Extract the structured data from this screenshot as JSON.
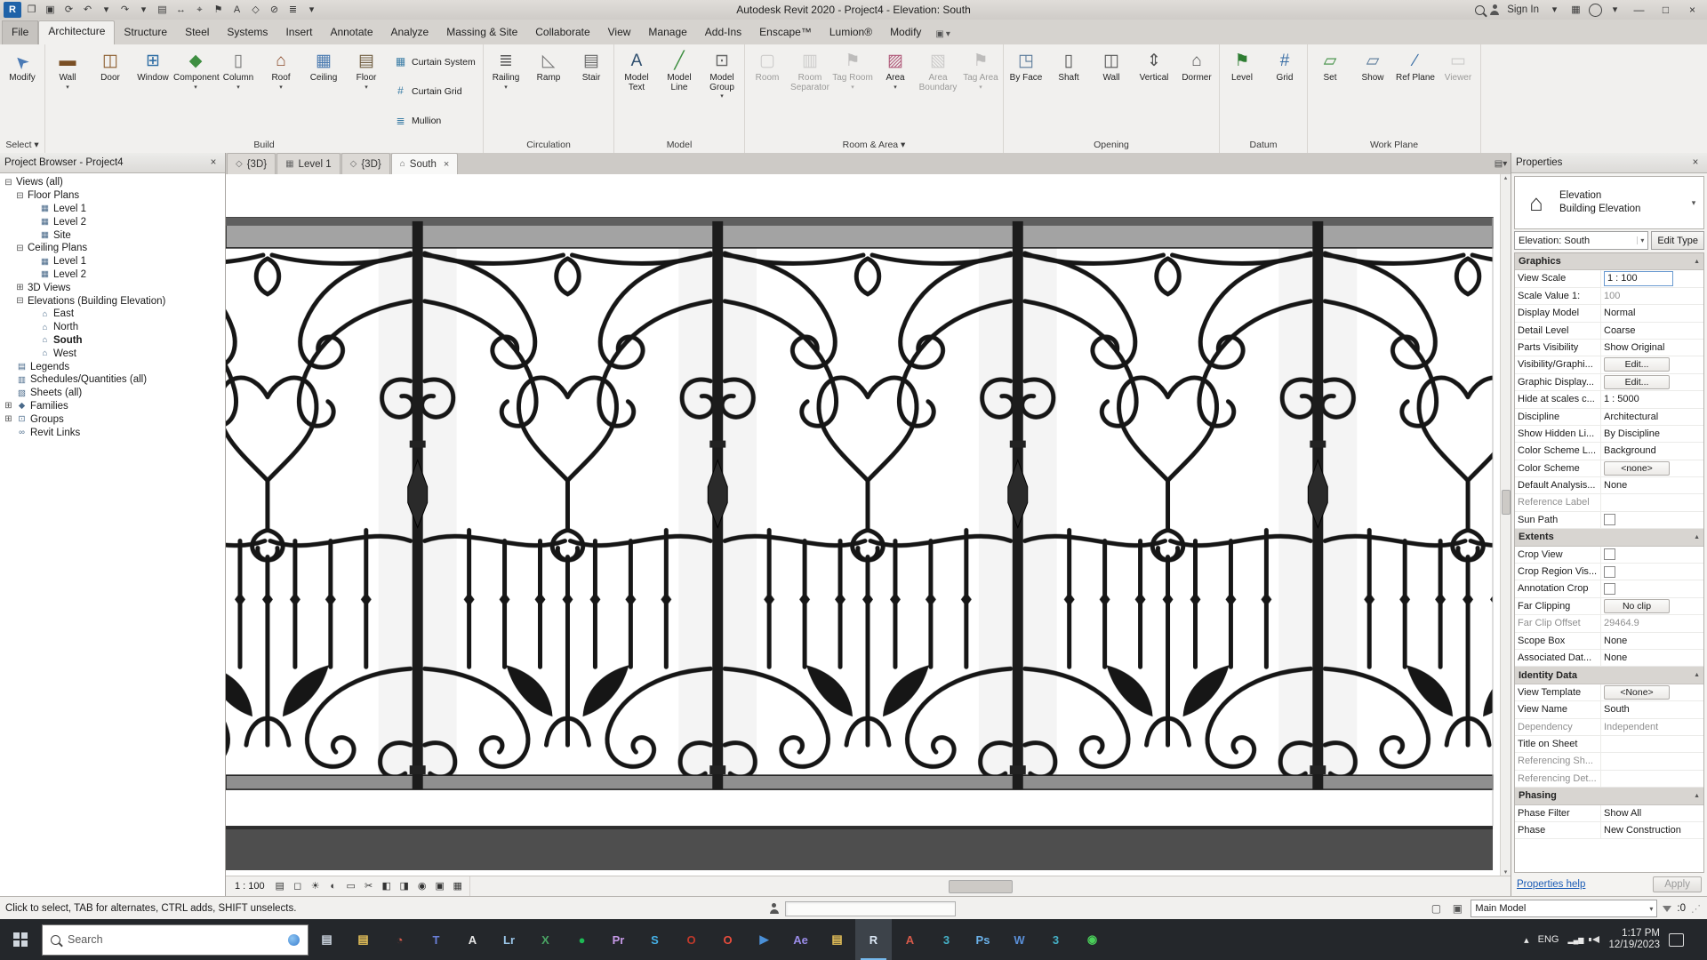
{
  "title_bar": {
    "title": "Autodesk Revit 2020 - Project4 - Elevation: South",
    "sign_in": "Sign In",
    "quick_access": [
      {
        "name": "application-menu-button",
        "glyph": "R"
      },
      {
        "name": "open-button",
        "glyph": "❐"
      },
      {
        "name": "save-button",
        "glyph": "▣"
      },
      {
        "name": "sync-with-central-button",
        "glyph": "⟳"
      },
      {
        "name": "undo-button",
        "glyph": "↶"
      },
      {
        "name": "undo-dropdown",
        "glyph": "▾"
      },
      {
        "name": "redo-button",
        "glyph": "↷"
      },
      {
        "name": "redo-dropdown",
        "glyph": "▾"
      },
      {
        "name": "print-button",
        "glyph": "▤"
      },
      {
        "name": "measure-button",
        "glyph": "↔"
      },
      {
        "name": "aligned-dimension-button",
        "glyph": "⌖"
      },
      {
        "name": "tag-by-category-button",
        "glyph": "⚑"
      },
      {
        "name": "text-button",
        "glyph": "A"
      },
      {
        "name": "default-3d-view-button",
        "glyph": "◇"
      },
      {
        "name": "section-button",
        "glyph": "⊘"
      },
      {
        "name": "thin-lines-button",
        "glyph": "≣"
      },
      {
        "name": "customize-quick-access-dropdown",
        "glyph": "▾"
      }
    ],
    "right_controls": [
      {
        "name": "search-icon",
        "glyph": "css-mag"
      },
      {
        "name": "user-icon",
        "glyph": "css-user"
      },
      {
        "name": "sign-in-button",
        "glyph": "",
        "use_label": "sign_in"
      },
      {
        "name": "sign-in-dropdown",
        "glyph": "▾"
      },
      {
        "name": "app-store-icon",
        "glyph": "▦"
      },
      {
        "name": "help-icon",
        "glyph": "css-help"
      },
      {
        "name": "help-dropdown",
        "glyph": "▾"
      },
      {
        "name": "minimize-button",
        "glyph": "—",
        "win": true
      },
      {
        "name": "maximize-button",
        "glyph": "□",
        "win": true
      },
      {
        "name": "close-button",
        "glyph": "×",
        "win": true
      }
    ]
  },
  "ribbon": {
    "tabs": [
      "File",
      "Architecture",
      "Structure",
      "Steel",
      "Systems",
      "Insert",
      "Annotate",
      "Analyze",
      "Massing & Site",
      "Collaborate",
      "View",
      "Manage",
      "Add-Ins",
      "Enscape™",
      "Lumion®",
      "Modify"
    ],
    "active_tab": "Architecture",
    "panels": [
      {
        "label": "Select",
        "arrow": true,
        "tools": [
          {
            "label": "Modify",
            "icon": "modify",
            "glyph": "➤",
            "color": "#4a7ab5"
          }
        ]
      },
      {
        "label": "Build",
        "tools": [
          {
            "label": "Wall",
            "icon": "wall",
            "glyph": "▬",
            "color": "#7a4f24",
            "arrow": true
          },
          {
            "label": "Door",
            "icon": "door",
            "glyph": "◫",
            "color": "#8a5a2a"
          },
          {
            "label": "Window",
            "icon": "window",
            "glyph": "⊞",
            "color": "#2e6da4"
          },
          {
            "label": "Component",
            "icon": "component",
            "glyph": "◆",
            "color": "#3e8e41",
            "arrow": true
          },
          {
            "label": "Column",
            "icon": "column",
            "glyph": "▯",
            "color": "#777777",
            "arrow": true
          },
          {
            "label": "Roof",
            "icon": "roof",
            "glyph": "⌂",
            "color": "#8a4a2a",
            "arrow": true
          },
          {
            "label": "Ceiling",
            "icon": "ceiling",
            "glyph": "▦",
            "color": "#4a7ab0"
          },
          {
            "label": "Floor",
            "icon": "floor",
            "glyph": "▤",
            "color": "#6e5b3e",
            "arrow": true
          }
        ],
        "stack": [
          {
            "label": "Curtain System",
            "icon": "curtain-system",
            "glyph": "▦",
            "color": "#3a7ca5"
          },
          {
            "label": "Curtain Grid",
            "icon": "curtain-grid",
            "glyph": "#",
            "color": "#3a7ca5"
          },
          {
            "label": "Mullion",
            "icon": "mullion",
            "glyph": "≣",
            "color": "#3a7ca5"
          }
        ]
      },
      {
        "label": "Circulation",
        "tools": [
          {
            "label": "Railing",
            "icon": "railing",
            "glyph": "≣",
            "color": "#555555",
            "arrow": true
          },
          {
            "label": "Ramp",
            "icon": "ramp",
            "glyph": "◺",
            "color": "#777777"
          },
          {
            "label": "Stair",
            "icon": "stair",
            "glyph": "▤",
            "color": "#666666"
          }
        ]
      },
      {
        "label": "Model",
        "tools": [
          {
            "label": "Model Text",
            "icon": "model-text",
            "glyph": "A",
            "color": "#2e4e6e"
          },
          {
            "label": "Model Line",
            "icon": "model-line",
            "glyph": "╱",
            "color": "#3e8e41"
          },
          {
            "label": "Model Group",
            "icon": "model-group",
            "glyph": "⊡",
            "color": "#666666",
            "arrow": true
          }
        ]
      },
      {
        "label": "Room & Area",
        "arrow": true,
        "tools": [
          {
            "label": "Room",
            "icon": "room",
            "glyph": "▢",
            "color": "#9a9a9a",
            "disabled": true
          },
          {
            "label": "Room Separator",
            "icon": "room-separator",
            "glyph": "▥",
            "color": "#9a9a9a",
            "disabled": true
          },
          {
            "label": "Tag Room",
            "icon": "tag-room",
            "glyph": "⚑",
            "color": "#777777",
            "arrow": true,
            "disabled": true
          },
          {
            "label": "Area",
            "icon": "area",
            "glyph": "▨",
            "color": "#b05a7a",
            "arrow": true
          },
          {
            "label": "Area Boundary",
            "icon": "area-boundary",
            "glyph": "▧",
            "color": "#9a9a9a",
            "disabled": true
          },
          {
            "label": "Tag Area",
            "icon": "tag-area",
            "glyph": "⚑",
            "color": "#777777",
            "arrow": true,
            "disabled": true
          }
        ]
      },
      {
        "label": "Opening",
        "tools": [
          {
            "label": "By Face",
            "icon": "opening-by-face",
            "glyph": "◳",
            "color": "#5a7a9a"
          },
          {
            "label": "Shaft",
            "icon": "shaft-opening",
            "glyph": "▯",
            "color": "#555555"
          },
          {
            "label": "Wall",
            "icon": "wall-opening",
            "glyph": "◫",
            "color": "#555555"
          },
          {
            "label": "Vertical",
            "icon": "vertical-opening",
            "glyph": "⇕",
            "color": "#555555"
          },
          {
            "label": "Dormer",
            "icon": "dormer-opening",
            "glyph": "⌂",
            "color": "#555555"
          }
        ]
      },
      {
        "label": "Datum",
        "tools": [
          {
            "label": "Level",
            "icon": "level",
            "glyph": "⚑",
            "color": "#2e7d32"
          },
          {
            "label": "Grid",
            "icon": "grid",
            "glyph": "#",
            "color": "#3a6ea5"
          }
        ]
      },
      {
        "label": "Work Plane",
        "tools": [
          {
            "label": "Set",
            "icon": "set-work-plane",
            "glyph": "▱",
            "color": "#3e8e41"
          },
          {
            "label": "Show",
            "icon": "show-work-plane",
            "glyph": "▱",
            "color": "#5a7a9a"
          },
          {
            "label": "Ref Plane",
            "icon": "ref-plane",
            "glyph": "∕",
            "color": "#3a6ea5"
          },
          {
            "label": "Viewer",
            "icon": "viewer",
            "glyph": "▭",
            "color": "#9a9a9a",
            "disabled": true
          }
        ]
      }
    ],
    "display_toggle_glyphs": [
      "▣",
      "▾"
    ]
  },
  "project_browser": {
    "title": "Project Browser - Project4",
    "close_glyph": "×",
    "icon_glyphs": {
      "plan": "▦",
      "elev": "⌂",
      "legend": "▤",
      "schedule": "▥",
      "sheet": "▧",
      "family": "◆",
      "group": "⊡",
      "link": "∞",
      "3d": "◇"
    },
    "tree": [
      {
        "label": "Views (all)",
        "depth": 0,
        "exp": "-"
      },
      {
        "label": "Floor Plans",
        "depth": 1,
        "exp": "-"
      },
      {
        "label": "Level 1",
        "depth": 2,
        "icon": "plan"
      },
      {
        "label": "Level 2",
        "depth": 2,
        "icon": "plan"
      },
      {
        "label": "Site",
        "depth": 2,
        "icon": "plan"
      },
      {
        "label": "Ceiling Plans",
        "depth": 1,
        "exp": "-"
      },
      {
        "label": "Level 1",
        "depth": 2,
        "icon": "plan"
      },
      {
        "label": "Level 2",
        "depth": 2,
        "icon": "plan"
      },
      {
        "label": "3D Views",
        "depth": 1,
        "exp": "+"
      },
      {
        "label": "Elevations (Building Elevation)",
        "depth": 1,
        "exp": "-"
      },
      {
        "label": "East",
        "depth": 2,
        "icon": "elev"
      },
      {
        "label": "North",
        "depth": 2,
        "icon": "elev"
      },
      {
        "label": "South",
        "depth": 2,
        "icon": "elev",
        "selected": true
      },
      {
        "label": "West",
        "depth": 2,
        "icon": "elev"
      },
      {
        "label": "Legends",
        "depth": 0,
        "icon": "legend"
      },
      {
        "label": "Schedules/Quantities (all)",
        "depth": 0,
        "icon": "schedule"
      },
      {
        "label": "Sheets (all)",
        "depth": 0,
        "icon": "sheet"
      },
      {
        "label": "Families",
        "depth": 0,
        "exp": "+",
        "icon": "family"
      },
      {
        "label": "Groups",
        "depth": 0,
        "exp": "+",
        "icon": "group"
      },
      {
        "label": "Revit Links",
        "depth": 0,
        "icon": "link"
      }
    ]
  },
  "view_tabs": [
    {
      "label": "{3D}",
      "icon": "3d"
    },
    {
      "label": "Level 1",
      "icon": "plan"
    },
    {
      "label": "{3D}",
      "icon": "3d"
    },
    {
      "label": "South",
      "icon": "elev",
      "active": true
    }
  ],
  "properties": {
    "title": "Properties",
    "close_glyph": "×",
    "type_name": "Elevation",
    "type_category": "Building Elevation",
    "selector": "Elevation: South",
    "edit_type": "Edit Type",
    "groups": [
      {
        "name": "Graphics",
        "rows": [
          {
            "l": "View Scale",
            "v": "1 : 100",
            "k": "input"
          },
          {
            "l": "Scale Value    1:",
            "v": "100",
            "k": "dim"
          },
          {
            "l": "Display Model",
            "v": "Normal",
            "k": "text"
          },
          {
            "l": "Detail Level",
            "v": "Coarse",
            "k": "text"
          },
          {
            "l": "Parts Visibility",
            "v": "Show Original",
            "k": "text"
          },
          {
            "l": "Visibility/Graphi...",
            "v": "Edit...",
            "k": "btn"
          },
          {
            "l": "Graphic Display...",
            "v": "Edit...",
            "k": "btn"
          },
          {
            "l": "Hide at scales c...",
            "v": "1 : 5000",
            "k": "text"
          },
          {
            "l": "Discipline",
            "v": "Architectural",
            "k": "text"
          },
          {
            "l": "Show Hidden Li...",
            "v": "By Discipline",
            "k": "text"
          },
          {
            "l": "Color Scheme L...",
            "v": "Background",
            "k": "text"
          },
          {
            "l": "Color Scheme",
            "v": "<none>",
            "k": "btn"
          },
          {
            "l": "Default Analysis...",
            "v": "None",
            "k": "text"
          },
          {
            "l": "Reference Label",
            "v": "",
            "k": "empty",
            "ld": true
          },
          {
            "l": "Sun Path",
            "v": "",
            "k": "check"
          }
        ]
      },
      {
        "name": "Extents",
        "rows": [
          {
            "l": "Crop View",
            "v": "",
            "k": "check"
          },
          {
            "l": "Crop Region Vis...",
            "v": "",
            "k": "check"
          },
          {
            "l": "Annotation Crop",
            "v": "",
            "k": "check"
          },
          {
            "l": "Far Clipping",
            "v": "No clip",
            "k": "btn"
          },
          {
            "l": "Far Clip Offset",
            "v": "29464.9",
            "k": "dim",
            "ld": true
          },
          {
            "l": "Scope Box",
            "v": "None",
            "k": "text"
          },
          {
            "l": "Associated Dat...",
            "v": "None",
            "k": "text"
          }
        ]
      },
      {
        "name": "Identity Data",
        "rows": [
          {
            "l": "View Template",
            "v": "<None>",
            "k": "btn"
          },
          {
            "l": "View Name",
            "v": "South",
            "k": "text"
          },
          {
            "l": "Dependency",
            "v": "Independent",
            "k": "dim",
            "ld": true
          },
          {
            "l": "Title on Sheet",
            "v": "",
            "k": "empty"
          },
          {
            "l": "Referencing Sh...",
            "v": "",
            "k": "empty",
            "ld": true
          },
          {
            "l": "Referencing Det...",
            "v": "",
            "k": "empty",
            "ld": true
          }
        ]
      },
      {
        "name": "Phasing",
        "rows": [
          {
            "l": "Phase Filter",
            "v": "Show All",
            "k": "text"
          },
          {
            "l": "Phase",
            "v": "New Construction",
            "k": "text"
          }
        ]
      }
    ],
    "help": "Properties help",
    "apply": "Apply"
  },
  "view_control_bar": {
    "scale": "1 : 100",
    "icons": [
      {
        "name": "detail-level-icon",
        "glyph": "▤"
      },
      {
        "name": "visual-style-icon",
        "glyph": "◻"
      },
      {
        "name": "sun-path-icon",
        "glyph": "☀"
      },
      {
        "name": "shadows-icon",
        "glyph": "◐"
      },
      {
        "name": "rendering-dialog-icon",
        "glyph": "▭"
      },
      {
        "name": "crop-view-icon",
        "glyph": "✂"
      },
      {
        "name": "crop-region-icon",
        "glyph": "◧"
      },
      {
        "name": "temporary-hide-icon",
        "glyph": "◨"
      },
      {
        "name": "reveal-hidden-icon",
        "glyph": "◉"
      },
      {
        "name": "temporary-view-properties-icon",
        "glyph": "▣"
      },
      {
        "name": "analysis-icon",
        "glyph": "▦"
      }
    ]
  },
  "status_bar": {
    "hint": "Click to select, TAB for alternates, CTRL adds, SHIFT unselects.",
    "main_model": "Main Model",
    "selection_count": ":0",
    "right_icons": [
      {
        "name": "design-options-icon",
        "glyph": "▣"
      },
      {
        "name": "exclude-options-icon",
        "glyph": "▢"
      }
    ]
  },
  "taskbar": {
    "search_placeholder": "Search",
    "language": "ENG",
    "time": "1:17 PM",
    "date": "12/19/2023",
    "apps": [
      {
        "name": "this-pc",
        "glyph": "▤",
        "fg": "#cfd8e3"
      },
      {
        "name": "file-explorer",
        "glyph": "▤",
        "fg": "#e8c35a"
      },
      {
        "name": "browser",
        "glyph": "◔",
        "fg": "#d85a4a"
      },
      {
        "name": "teams",
        "glyph": "T",
        "fg": "#6a7fd8"
      },
      {
        "name": "notepad",
        "glyph": "A",
        "fg": "#e8e8e8"
      },
      {
        "name": "lightroom",
        "glyph": "Lr",
        "fg": "#9ac5e8"
      },
      {
        "name": "excel",
        "glyph": "X",
        "fg": "#4aa564"
      },
      {
        "name": "spotify",
        "glyph": "●",
        "fg": "#1db954"
      },
      {
        "name": "premiere",
        "glyph": "Pr",
        "fg": "#c79ae8"
      },
      {
        "name": "skype",
        "glyph": "S",
        "fg": "#45b0e6"
      },
      {
        "name": "opera-beta",
        "glyph": "O",
        "fg": "#c0392b"
      },
      {
        "name": "opera",
        "glyph": "O",
        "fg": "#e74c3c"
      },
      {
        "name": "media-player",
        "glyph": "▶",
        "fg": "#4a90d8"
      },
      {
        "name": "after-effects",
        "glyph": "Ae",
        "fg": "#9a8ce8"
      },
      {
        "name": "folder",
        "glyph": "▤",
        "fg": "#e8c35a"
      },
      {
        "name": "revit",
        "glyph": "R",
        "fg": "#dce8f5",
        "active": true
      },
      {
        "name": "autocad",
        "glyph": "A",
        "fg": "#d85a4a"
      },
      {
        "name": "3ds-max",
        "glyph": "3",
        "fg": "#45b0c6"
      },
      {
        "name": "photoshop",
        "glyph": "Ps",
        "fg": "#6ab0e8"
      },
      {
        "name": "word",
        "glyph": "W",
        "fg": "#5a8fd8"
      },
      {
        "name": "3ds-max-2",
        "glyph": "3",
        "fg": "#45b0c6"
      },
      {
        "name": "wechat",
        "glyph": "◉",
        "fg": "#4ad05a"
      }
    ]
  }
}
